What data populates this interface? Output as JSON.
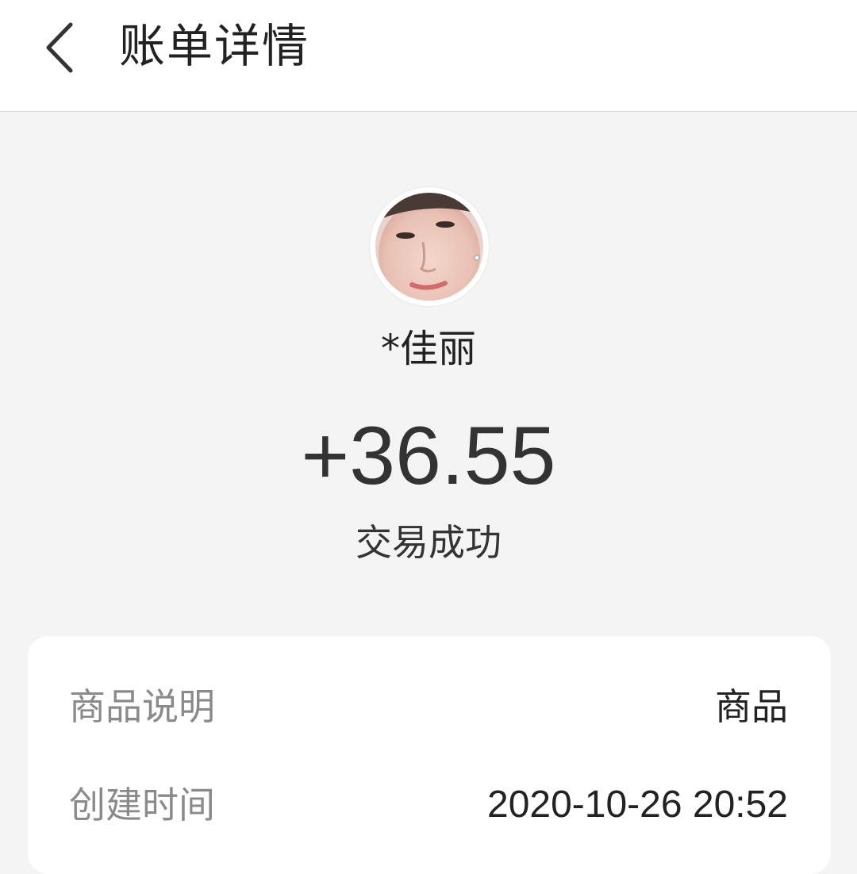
{
  "header": {
    "back_icon": "chevron-left-icon",
    "title": "账单详情"
  },
  "payer": {
    "avatar": "avatar-photo",
    "name": "*佳丽"
  },
  "transaction": {
    "amount": "+36.55",
    "status": "交易成功"
  },
  "details": {
    "rows": [
      {
        "label": "商品说明",
        "value": "商品"
      },
      {
        "label": "创建时间",
        "value": "2020-10-26 20:52"
      }
    ]
  },
  "colors": {
    "background": "#f4f4f4",
    "card": "#ffffff",
    "label_text": "#8a8a8a",
    "primary_text": "#333333"
  }
}
